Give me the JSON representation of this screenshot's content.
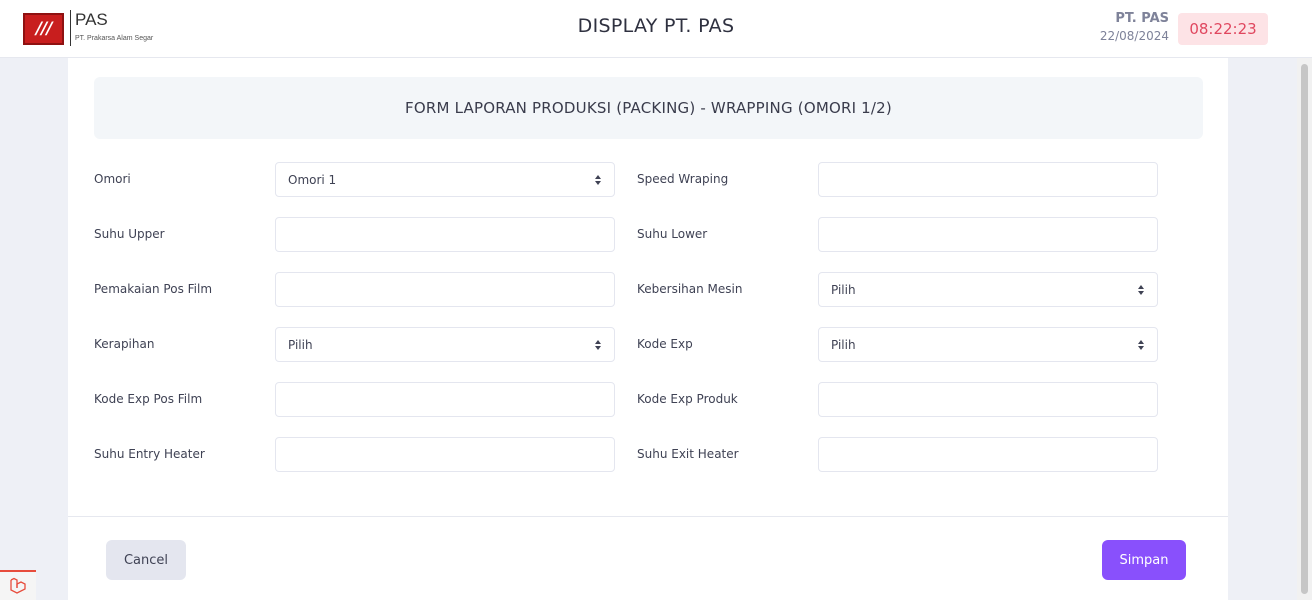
{
  "header": {
    "logo_mark": "///",
    "logo_name": "PAS",
    "logo_subtitle": "PT. Prakarsa Alam Segar",
    "title": "DISPLAY PT. PAS",
    "company": "PT. PAS",
    "date": "22/08/2024",
    "clock": "08:22:23"
  },
  "form": {
    "heading": "FORM LAPORAN PRODUKSI (PACKING) - WRAPPING (OMORI 1/2)",
    "fields": {
      "omori": {
        "label": "Omori",
        "value": "Omori 1"
      },
      "speed_wraping": {
        "label": "Speed Wraping",
        "value": ""
      },
      "suhu_upper": {
        "label": "Suhu Upper",
        "value": ""
      },
      "suhu_lower": {
        "label": "Suhu Lower",
        "value": ""
      },
      "pemakaian_pos_film": {
        "label": "Pemakaian Pos Film",
        "value": ""
      },
      "kebersihan_mesin": {
        "label": "Kebersihan Mesin",
        "value": "Pilih"
      },
      "kerapihan": {
        "label": "Kerapihan",
        "value": "Pilih"
      },
      "kode_exp": {
        "label": "Kode Exp",
        "value": "Pilih"
      },
      "kode_exp_pos_film": {
        "label": "Kode Exp Pos Film",
        "value": ""
      },
      "kode_exp_produk": {
        "label": "Kode Exp Produk",
        "value": ""
      },
      "suhu_entry_heater": {
        "label": "Suhu Entry Heater",
        "value": ""
      },
      "suhu_exit_heater": {
        "label": "Suhu Exit Heater",
        "value": ""
      }
    },
    "cancel_label": "Cancel",
    "save_label": "Simpan"
  },
  "colors": {
    "primary": "#8950fc",
    "clock_bg": "#fde3e6",
    "clock_text": "#e0475f",
    "logo": "#c81e1e"
  },
  "icons": {
    "select_caret": "select-caret-icon",
    "corner": "laravel-icon"
  }
}
